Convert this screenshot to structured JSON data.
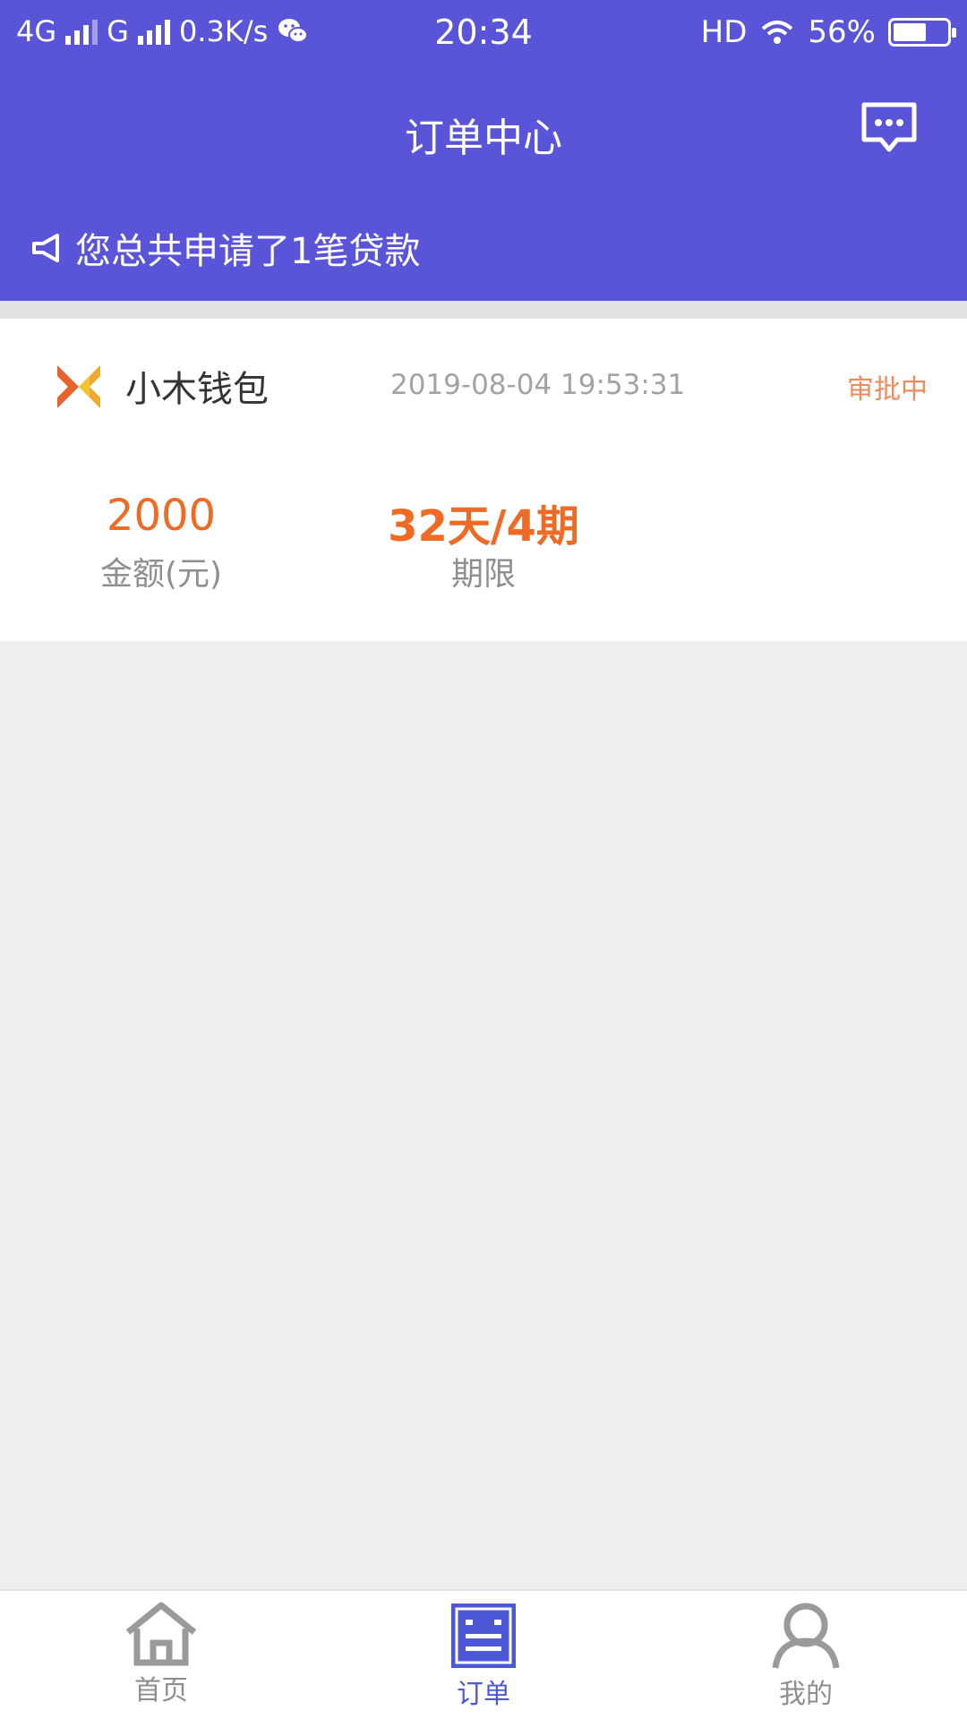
{
  "status_bar": {
    "network_1": "4G",
    "network_2": "G",
    "speed": "0.3K/s",
    "time": "20:34",
    "hd": "HD",
    "battery": "56%",
    "battery_level": 0.56
  },
  "header": {
    "title": "订单中心",
    "notice": "您总共申请了1笔贷款"
  },
  "order": {
    "brand": "小木钱包",
    "datetime": "2019-08-04 19:53:31",
    "status": "审批中",
    "amount": "2000",
    "amount_label": "金额(元)",
    "term": "32天/4期",
    "term_label": "期限"
  },
  "bottom_nav": {
    "items": [
      {
        "label": "首页",
        "icon": "home-icon",
        "active": false
      },
      {
        "label": "订单",
        "icon": "order-list-icon",
        "active": true
      },
      {
        "label": "我的",
        "icon": "user-icon",
        "active": false
      }
    ]
  },
  "colors": {
    "primary": "#5a55d8",
    "accent_orange": "#ee6a25",
    "status_orange": "#f08a5d",
    "nav_active": "#4d58d6"
  }
}
